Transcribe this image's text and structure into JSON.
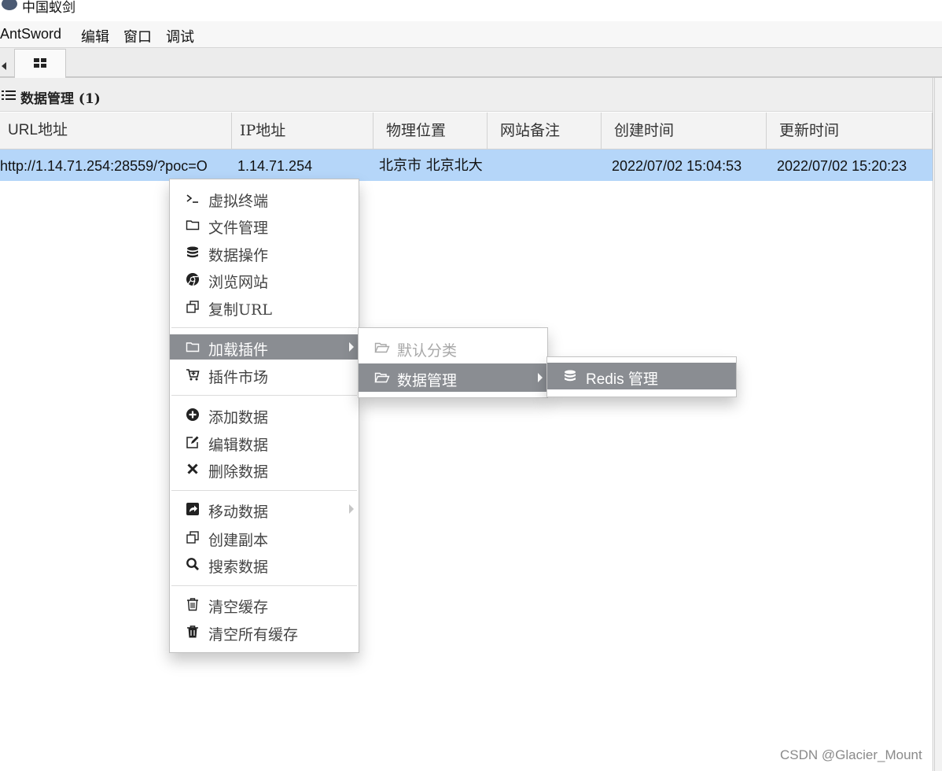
{
  "window": {
    "title": "中国蚁剑"
  },
  "menubar": [
    "AntSword",
    "编辑",
    "窗口",
    "调试"
  ],
  "panel": {
    "title": "数据管理 (1)"
  },
  "table": {
    "columns": [
      "URL地址",
      "IP地址",
      "物理位置",
      "网站备注",
      "创建时间",
      "更新时间"
    ],
    "rows": [
      {
        "url": "http://1.14.71.254:28559/?poc=O",
        "ip": "1.14.71.254",
        "location": "北京市 北京北大",
        "note": "",
        "created": "2022/07/02 15:04:53",
        "updated": "2022/07/02 15:20:23"
      }
    ]
  },
  "context_menu": {
    "items": [
      {
        "label": "虚拟终端",
        "icon": "terminal-icon"
      },
      {
        "label": "文件管理",
        "icon": "folder-icon"
      },
      {
        "label": "数据操作",
        "icon": "database-icon"
      },
      {
        "label": "浏览网站",
        "icon": "chrome-icon"
      },
      {
        "label": "复制URL",
        "icon": "copy-icon"
      },
      {
        "label": "加载插件",
        "icon": "folder-icon",
        "highlighted": true,
        "submenu": true
      },
      {
        "label": "插件市场",
        "icon": "cart-icon"
      },
      {
        "label": "添加数据",
        "icon": "plus-circle-icon"
      },
      {
        "label": "编辑数据",
        "icon": "edit-icon"
      },
      {
        "label": "删除数据",
        "icon": "close-icon"
      },
      {
        "label": "移动数据",
        "icon": "share-icon",
        "submenu": true
      },
      {
        "label": "创建副本",
        "icon": "copy-icon"
      },
      {
        "label": "搜索数据",
        "icon": "search-icon"
      },
      {
        "label": "清空缓存",
        "icon": "trash-outline-icon"
      },
      {
        "label": "清空所有缓存",
        "icon": "trash-icon"
      }
    ]
  },
  "plugin_submenu": {
    "items": [
      {
        "label": "默认分类",
        "icon": "folder-open-icon",
        "disabled": true
      },
      {
        "label": "数据管理",
        "icon": "folder-open-icon",
        "highlighted": true,
        "submenu": true
      }
    ]
  },
  "data_submenu": {
    "items": [
      {
        "label": "Redis 管理",
        "icon": "database-icon",
        "highlighted": true
      }
    ]
  },
  "watermark": "CSDN @Glacier_Mount",
  "colors": {
    "selected_row": "#b5d6f9",
    "menu_highlight": "#8a8d92"
  }
}
